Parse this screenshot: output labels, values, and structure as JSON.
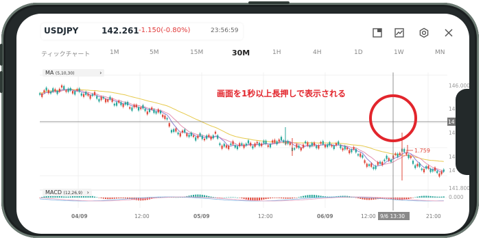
{
  "header": {
    "symbol": "USDJPY",
    "price": "142.261",
    "change": "-1.150(-0.80%)",
    "time": "23:56:59",
    "icons": [
      "layout-icon",
      "indicator-icon",
      "settings-icon",
      "close-icon"
    ]
  },
  "timeframes": [
    {
      "label": "ティックチャート",
      "active": false
    },
    {
      "label": "1M",
      "active": false
    },
    {
      "label": "5M",
      "active": false
    },
    {
      "label": "15M",
      "active": false
    },
    {
      "label": "30M",
      "active": true
    },
    {
      "label": "1H",
      "active": false
    },
    {
      "label": "4H",
      "active": false
    },
    {
      "label": "1D",
      "active": false
    },
    {
      "label": "1W",
      "active": false
    },
    {
      "label": "MN",
      "active": false
    }
  ],
  "chart": {
    "ma_label": "MA",
    "ma_params": "(5,10,30)",
    "macd_label": "MACD",
    "macd_params": "(12,26,9)",
    "y_ticks": [
      "146.000",
      "141.800"
    ],
    "partial_ticks": [
      "14",
      "14",
      "14",
      "14"
    ],
    "crosshair_price": "14",
    "macd_tick": "0.000",
    "x_labels": [
      "04/09",
      "12:00",
      "05/09",
      "12:00",
      "06/09",
      "12:00",
      "21:00"
    ],
    "crosshair_time": "9/6 13:30",
    "high_label": "1.759",
    "colors": {
      "up": "#26a69a",
      "down": "#e0473a",
      "ma5": "#8a7fd4",
      "ma10": "#e58fb0",
      "ma30": "#e6c94a"
    }
  },
  "annotation": "画面を1秒以上長押しで表示される"
}
